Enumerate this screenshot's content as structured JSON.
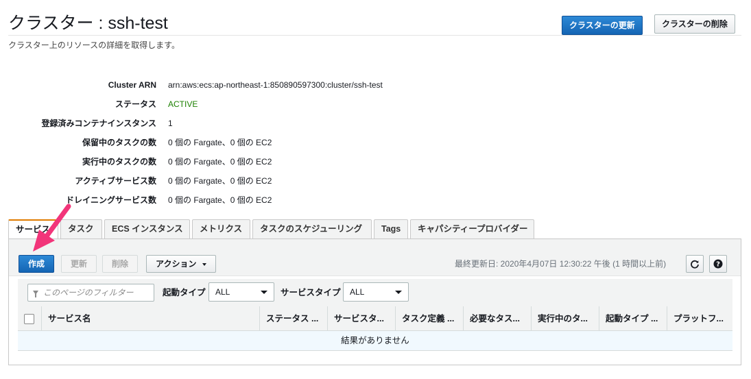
{
  "header": {
    "title": "クラスター : ssh-test",
    "subtitle": "クラスター上のリソースの詳細を取得します。",
    "update_button": "クラスターの更新",
    "delete_button": "クラスターの削除"
  },
  "details": [
    {
      "label": "Cluster ARN",
      "value": "arn:aws:ecs:ap-northeast-1:850890597300:cluster/ssh-test"
    },
    {
      "label": "ステータス",
      "value": "ACTIVE"
    },
    {
      "label": "登録済みコンテナインスタンス",
      "value": "1"
    },
    {
      "label": "保留中のタスクの数",
      "value": "0 個の Fargate、0 個の EC2"
    },
    {
      "label": "実行中のタスクの数",
      "value": "0 個の Fargate、0 個の EC2"
    },
    {
      "label": "アクティブサービス数",
      "value": "0 個の Fargate、0 個の EC2"
    },
    {
      "label": "ドレイニングサービス数",
      "value": "0 個の Fargate、0 個の EC2"
    }
  ],
  "tabs": [
    {
      "label": "サービス"
    },
    {
      "label": "タスク"
    },
    {
      "label": "ECS インスタンス"
    },
    {
      "label": "メトリクス"
    },
    {
      "label": "タスクのスケジューリング"
    },
    {
      "label": "Tags"
    },
    {
      "label": "キャパシティープロバイダー"
    }
  ],
  "toolbar": {
    "create": "作成",
    "update": "更新",
    "delete": "削除",
    "actions": "アクション",
    "last_updated": "最終更新日: 2020年4月07日 12:30:22 午後 (1 時間以上前)"
  },
  "filters": {
    "placeholder": "このページのフィルター",
    "launch_type_label": "起動タイプ",
    "launch_type_value": "ALL",
    "service_type_label": "サービスタイプ",
    "service_type_value": "ALL"
  },
  "table": {
    "columns": [
      "サービス名",
      "ステータス ...",
      "サービスタ...",
      "タスク定義 ...",
      "必要なタス...",
      "実行中のタ...",
      "起動タイプ ...",
      "プラットフ..."
    ],
    "empty_message": "結果がありません"
  },
  "colors": {
    "accent_tab": "#e07b00",
    "primary": "#1e74c8",
    "active_status": "#1d8102",
    "annotation_arrow": "#f2357a"
  },
  "icons": [
    "refresh-icon",
    "help-icon",
    "filter-icon",
    "chevron-down-icon",
    "annotation-arrow"
  ]
}
